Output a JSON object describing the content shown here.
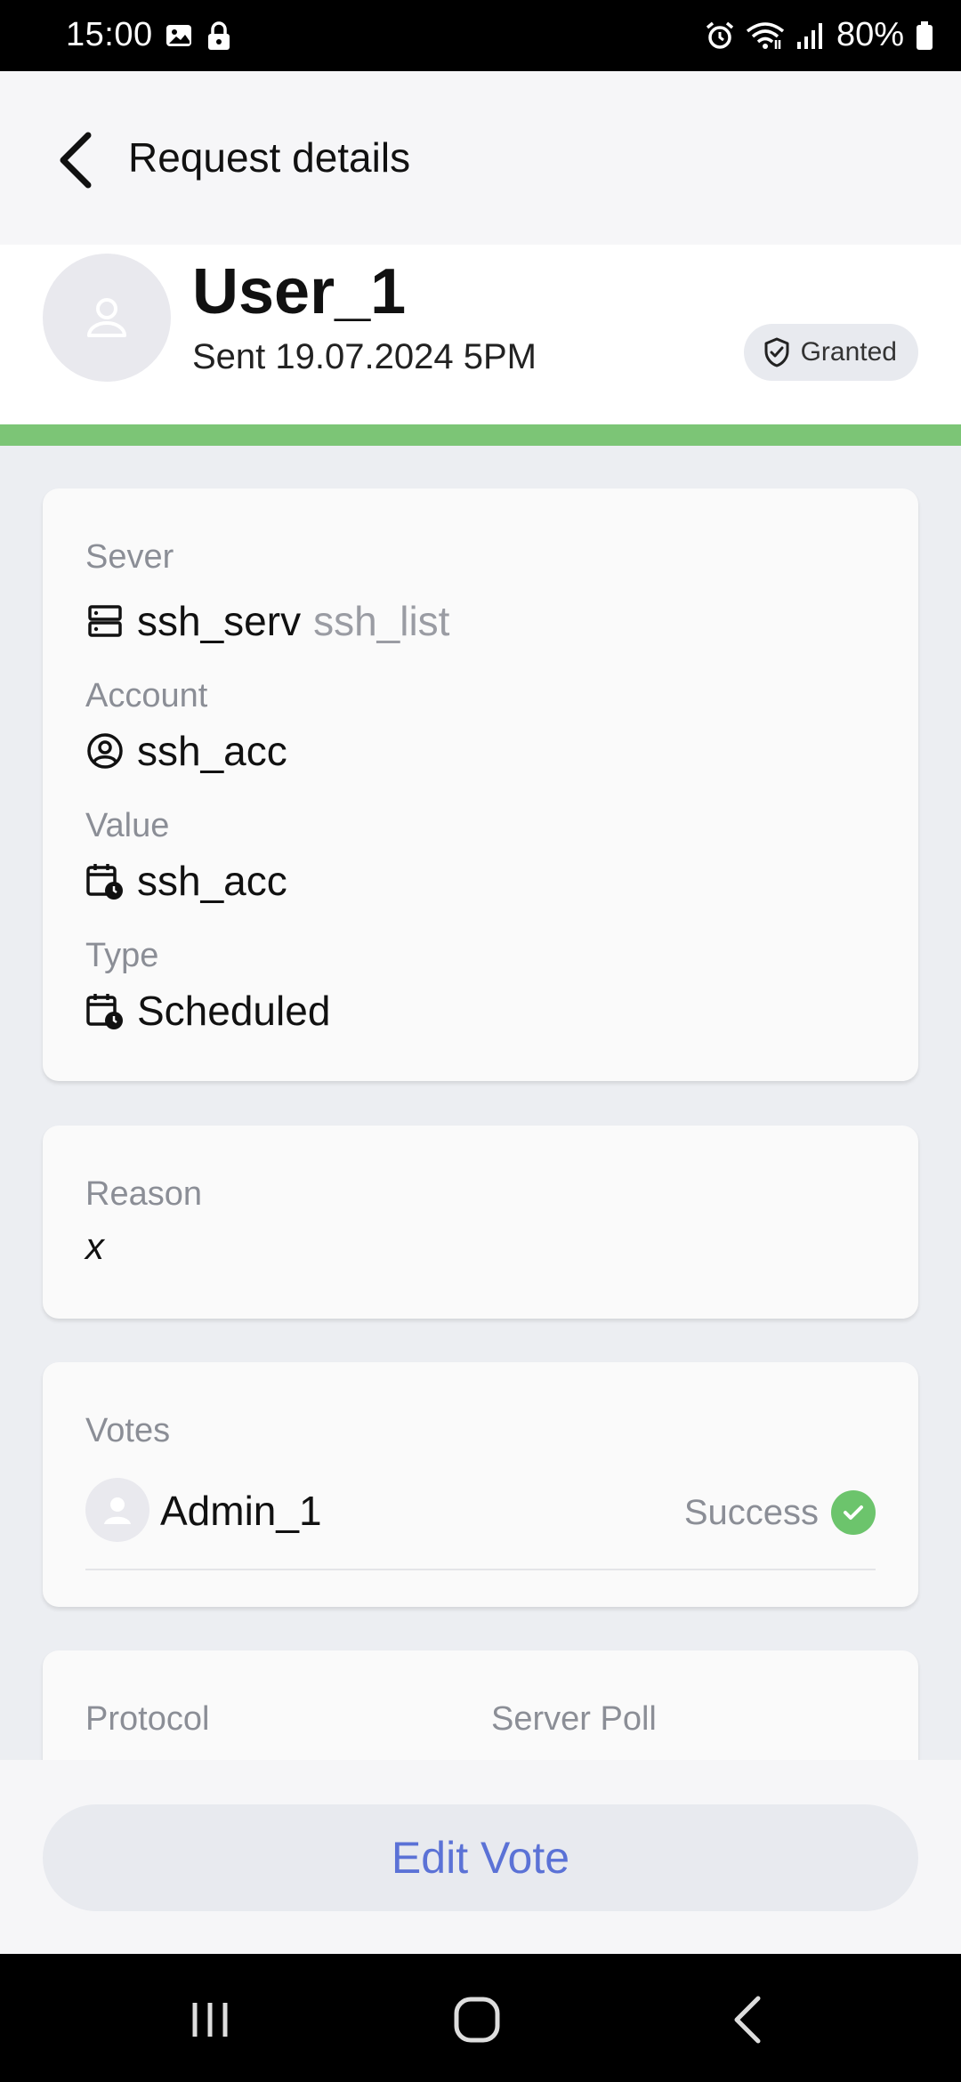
{
  "status_bar": {
    "time": "15:00",
    "battery": "80%",
    "left_icons": [
      "image-icon",
      "lock-icon"
    ],
    "right_icons": [
      "alarm-icon",
      "wifi-icon",
      "signal-icon",
      "battery-icon"
    ]
  },
  "header": {
    "title": "Request details"
  },
  "user": {
    "name": "User_1",
    "sent": "Sent 19.07.2024 5PM",
    "status": "Granted"
  },
  "details": {
    "server_label": "Sever",
    "server_value": "ssh_serv",
    "server_sub": "ssh_list",
    "account_label": "Account",
    "account_value": "ssh_acc",
    "value_label": "Value",
    "value_value": "ssh_acc",
    "type_label": "Type",
    "type_value": "Scheduled"
  },
  "reason": {
    "label": "Reason",
    "value": "x"
  },
  "votes": {
    "label": "Votes",
    "items": [
      {
        "name": "Admin_1",
        "status": "Success"
      }
    ]
  },
  "extra": {
    "protocol_label": "Protocol",
    "server_poll_label": "Server Poll"
  },
  "footer": {
    "edit_vote_label": "Edit Vote"
  },
  "colors": {
    "accent": "#5b72d6",
    "success": "#6cc46c",
    "status_bar_green": "#7cc576"
  }
}
